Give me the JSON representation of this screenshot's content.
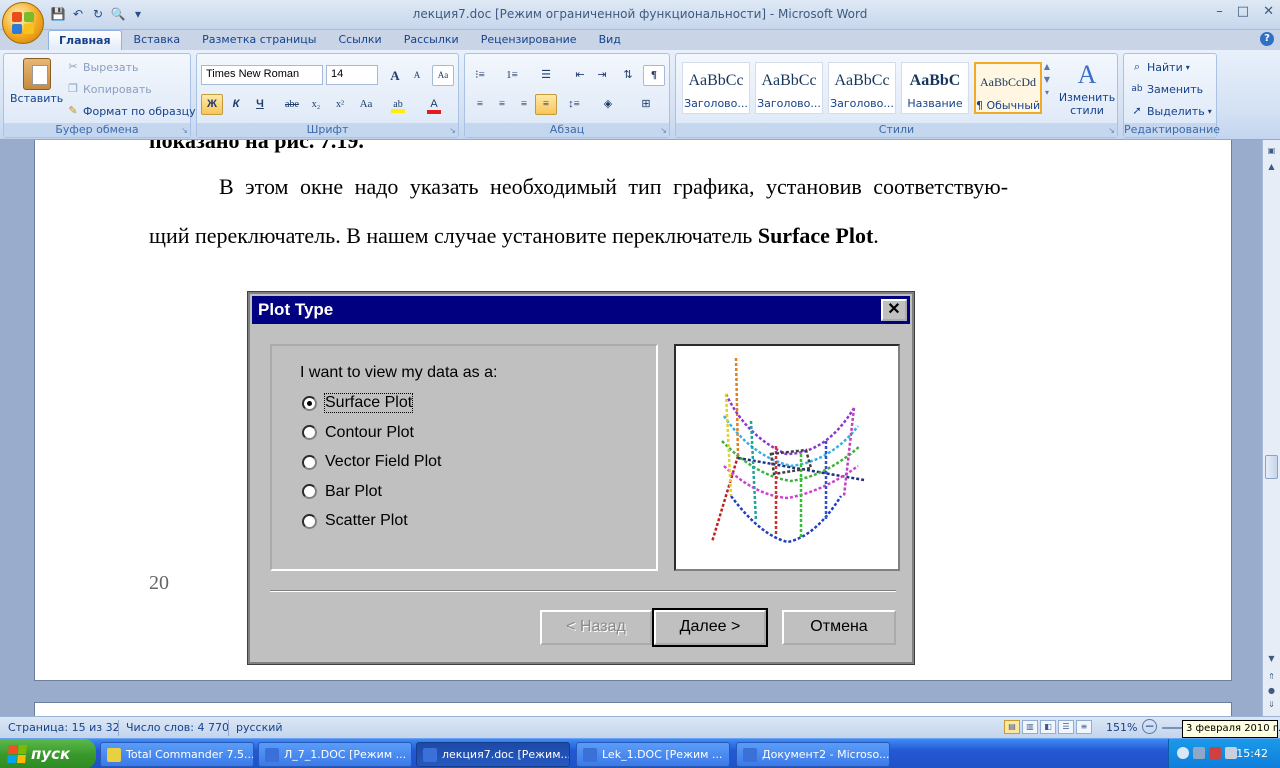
{
  "window": {
    "title": "лекция7.doc [Режим ограниченной функциональности] - Microsoft Word",
    "minimize": "–",
    "maximize": "□",
    "close": "✕"
  },
  "qat": {
    "save": "💾",
    "undo": "↶",
    "redo": "↻",
    "preview": "🔍",
    "more": "▾"
  },
  "tabs": [
    "Главная",
    "Вставка",
    "Разметка страницы",
    "Ссылки",
    "Рассылки",
    "Рецензирование",
    "Вид"
  ],
  "help": "?",
  "clipboard": {
    "paste": "Вставить",
    "cut": "Вырезать",
    "copy": "Копировать",
    "format_painter": "Формат по образцу",
    "group": "Буфер обмена"
  },
  "font": {
    "name": "Times New Roman",
    "size": "14",
    "group": "Шрифт",
    "bold": "Ж",
    "italic": "К",
    "underline": "Ч",
    "strike": "abe",
    "sub": "x₂",
    "sup": "x²",
    "case": "Aa",
    "grow": "A",
    "shrink": "A",
    "clear": "Aa"
  },
  "paragraph": {
    "group": "Абзац",
    "pilcrow": "¶"
  },
  "styles": {
    "group": "Стили",
    "items": [
      {
        "sample": "AaBbCc",
        "name": "Заголово..."
      },
      {
        "sample": "AaBbCc",
        "name": "Заголово..."
      },
      {
        "sample": "AaBbCc",
        "name": "Заголово..."
      },
      {
        "sample": "AaBbC",
        "name": "Название"
      },
      {
        "sample": "AaBbCcDd",
        "name": "¶ Обычный"
      }
    ],
    "change": "Изменить стили"
  },
  "editing": {
    "find": "Найти",
    "replace": "Заменить",
    "select": "Выделить",
    "group": "Редактирование"
  },
  "document": {
    "line0": "показано на рис. 7.19.",
    "line1": "В этом окне надо указать необходимый тип графика, установив соответствую-",
    "line2_pre": "щий переключатель. В нашем случае установите переключатель ",
    "line2_bold": "Surface Plot",
    "line2_post": ".",
    "page_number": "20"
  },
  "dialog": {
    "title": "Plot Type",
    "close": "✕",
    "prompt": "I want to view my data as a:",
    "options": [
      "Surface Plot",
      "Contour Plot",
      "Vector Field Plot",
      "Bar Plot",
      "Scatter Plot"
    ],
    "selected": "Surface Plot",
    "back": "< Назад",
    "next": "Далее >",
    "cancel": "Отмена"
  },
  "status": {
    "page": "Страница: 15 из 32",
    "words": "Число слов: 4 770",
    "language": "русский",
    "zoom": "151%"
  },
  "tooltip": "3 февраля 2010 г.",
  "taskbar": {
    "start": "пуск",
    "tasks": [
      "Total Commander 7.5...",
      "Л_7_1.DOC [Режим ...",
      "лекция7.doc [Режим...",
      "Lek_1.DOC [Режим ...",
      "Документ2 - Microso..."
    ],
    "clock": "15:42"
  },
  "colors": {
    "accent": "#2052c6",
    "dialog_title": "#000080",
    "start": "#3a9a2c"
  }
}
